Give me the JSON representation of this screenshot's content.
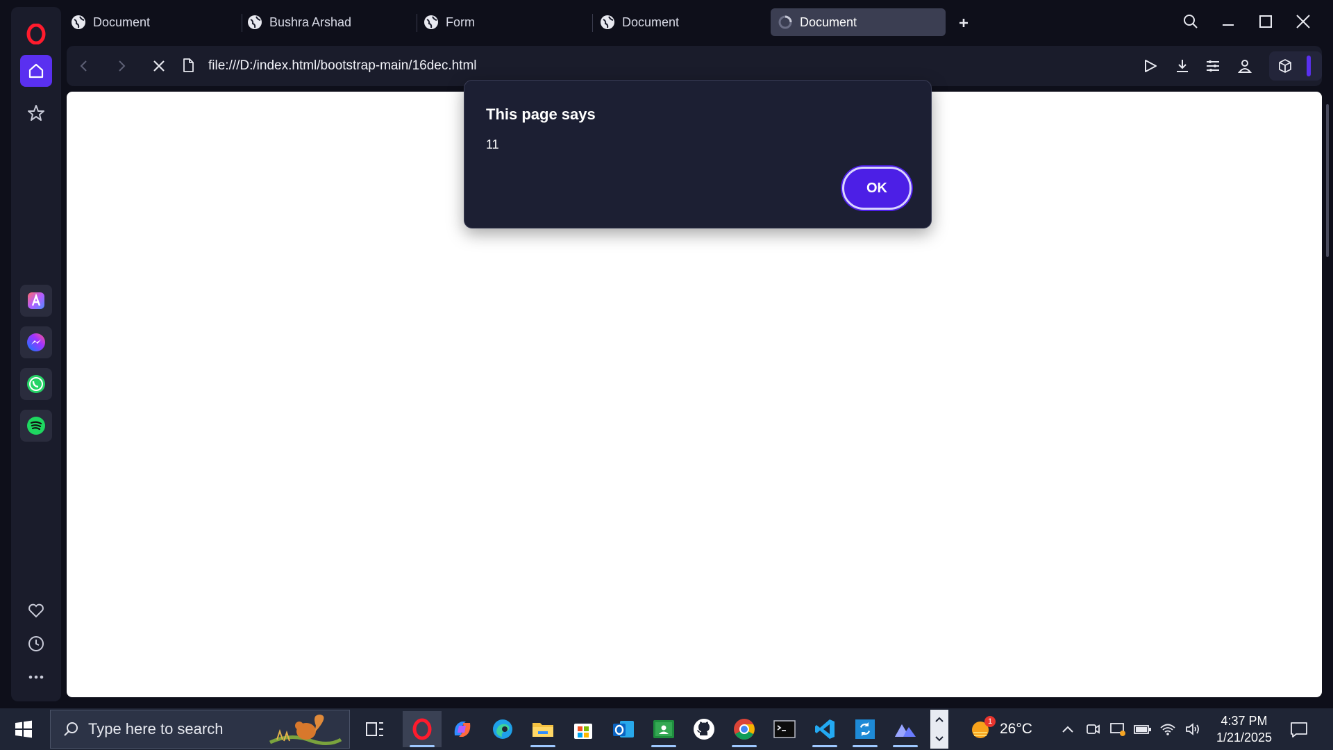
{
  "browser": {
    "tabs": [
      {
        "title": "Document",
        "icon": "globe-icon",
        "active": false
      },
      {
        "title": "Bushra Arshad",
        "icon": "globe-icon",
        "active": false
      },
      {
        "title": "Form",
        "icon": "globe-icon",
        "active": false
      },
      {
        "title": "Document",
        "icon": "globe-icon",
        "active": false
      },
      {
        "title": "Document",
        "icon": "loading-spinner-icon",
        "active": true
      }
    ],
    "url": "file:///D:/index.html/bootstrap-main/16dec.html",
    "accent_color": "#5a30f0"
  },
  "dialog": {
    "title": "This page says",
    "message": "11",
    "ok_label": "OK",
    "button_color": "#4c1fe6"
  },
  "taskbar": {
    "search_placeholder": "Type here to search",
    "temperature": "26°C",
    "weather_badge": "1",
    "time": "4:37 PM",
    "date": "1/21/2025",
    "apps": [
      "task-view",
      "opera",
      "copilot",
      "edge",
      "file-explorer",
      "microsoft-store",
      "outlook",
      "google-classroom",
      "github",
      "chrome",
      "terminal",
      "vscode",
      "sync-app",
      "photos"
    ]
  }
}
